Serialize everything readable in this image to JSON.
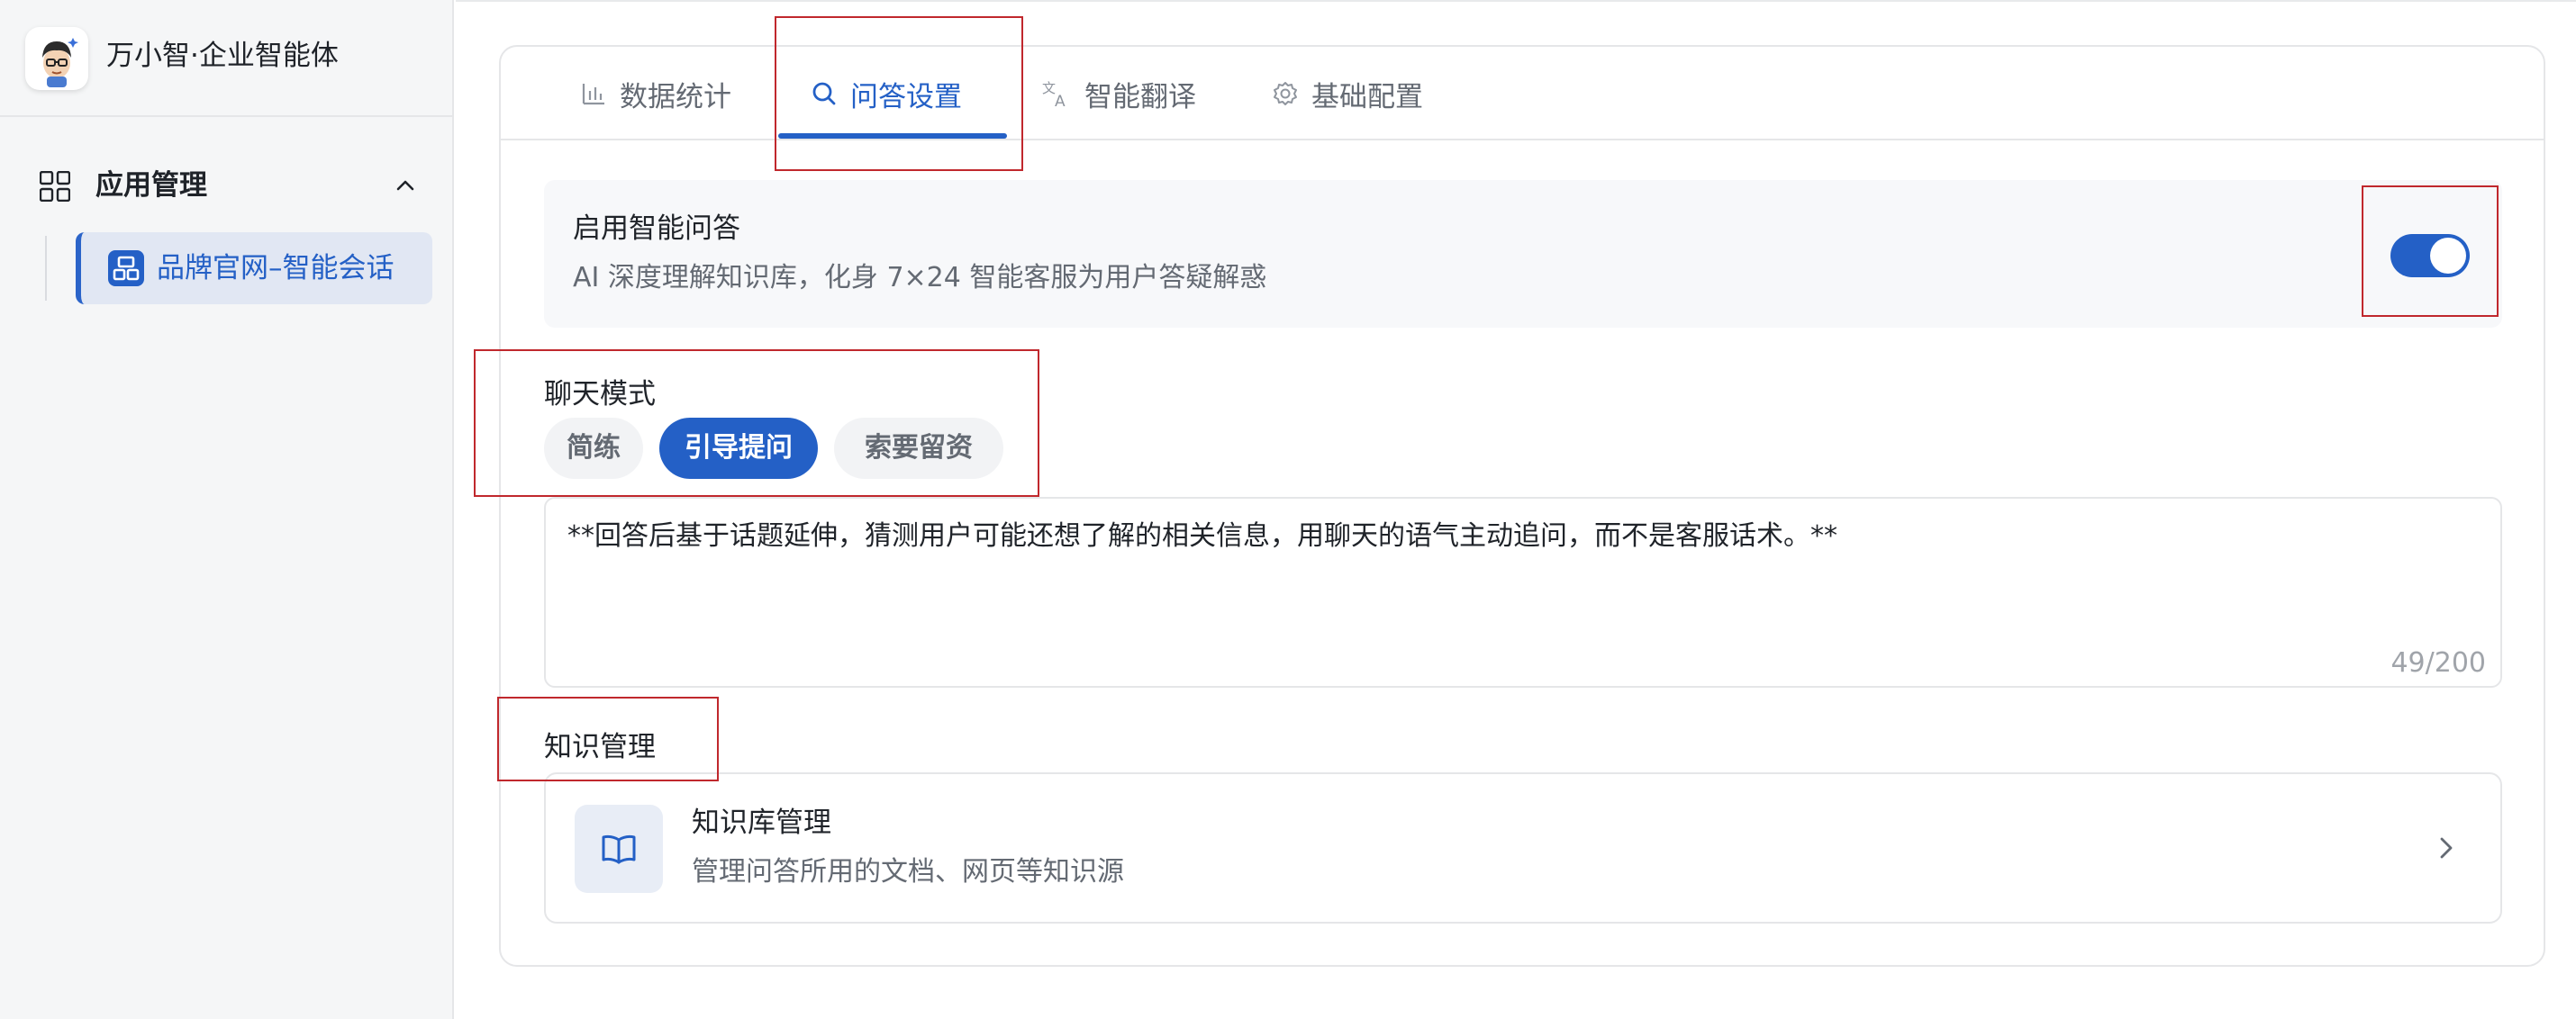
{
  "sidebar": {
    "brand_name": "万小智·企业智能体",
    "group_label": "应用管理",
    "active_item_label": "品牌官网–智能会话"
  },
  "tabs": [
    {
      "label": "数据统计",
      "icon": "bar-chart-icon"
    },
    {
      "label": "问答设置",
      "icon": "search-icon"
    },
    {
      "label": "智能翻译",
      "icon": "translate-icon"
    },
    {
      "label": "基础配置",
      "icon": "gear-icon"
    }
  ],
  "qa_toggle": {
    "title": "启用智能问答",
    "description": "AI 深度理解知识库，化身 7×24 智能客服为用户答疑解惑",
    "enabled": true
  },
  "chat_mode": {
    "label": "聊天模式",
    "options": [
      "简练",
      "引导提问",
      "索要留资"
    ],
    "selected": "引导提问"
  },
  "prompt": {
    "value": "**回答后基于话题延伸，猜测用户可能还想了解的相关信息，用聊天的语气主动追问，而不是客服话术。**",
    "count": "49/200"
  },
  "knowledge": {
    "section_label": "知识管理",
    "card_title": "知识库管理",
    "card_description": "管理问答所用的文档、网页等知识源"
  },
  "colors": {
    "accent": "#2460c6",
    "highlight_box": "#c0282d"
  }
}
